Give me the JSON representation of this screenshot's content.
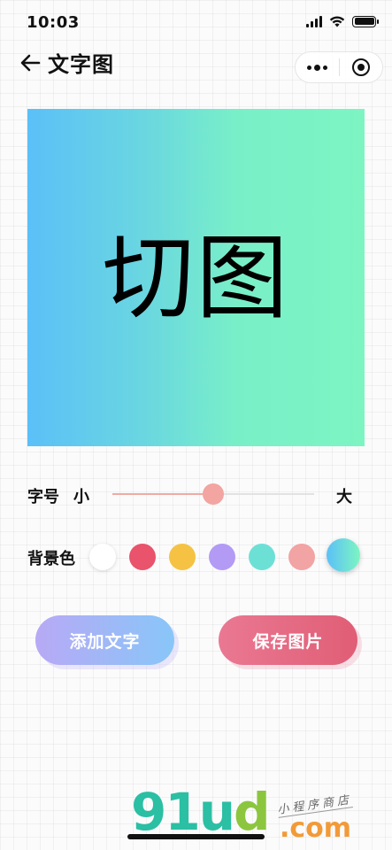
{
  "status_bar": {
    "time": "10:03"
  },
  "nav": {
    "title": "文字图"
  },
  "preview": {
    "text": "切图",
    "gradient_start": "#5bc0f8",
    "gradient_end": "#7df5c2"
  },
  "font_size": {
    "label": "字号",
    "min_label": "小",
    "max_label": "大",
    "value_fraction": 0.5
  },
  "background": {
    "label": "背景色",
    "swatches": [
      "#ffffff",
      "#e9536b",
      "#f5c243",
      "#b39af5",
      "#6de0d6",
      "#f2a3a3",
      "gradient"
    ]
  },
  "buttons": {
    "add_text": "添加文字",
    "save_image": "保存图片"
  },
  "watermark": {
    "logo_part1": "91u",
    "logo_part2": "d",
    "dotcom": ".com",
    "tagline": "小程序商店"
  },
  "icons": [
    "back-arrow-icon",
    "more-dots-icon",
    "close-target-icon",
    "signal-icon",
    "wifi-icon",
    "battery-icon"
  ]
}
